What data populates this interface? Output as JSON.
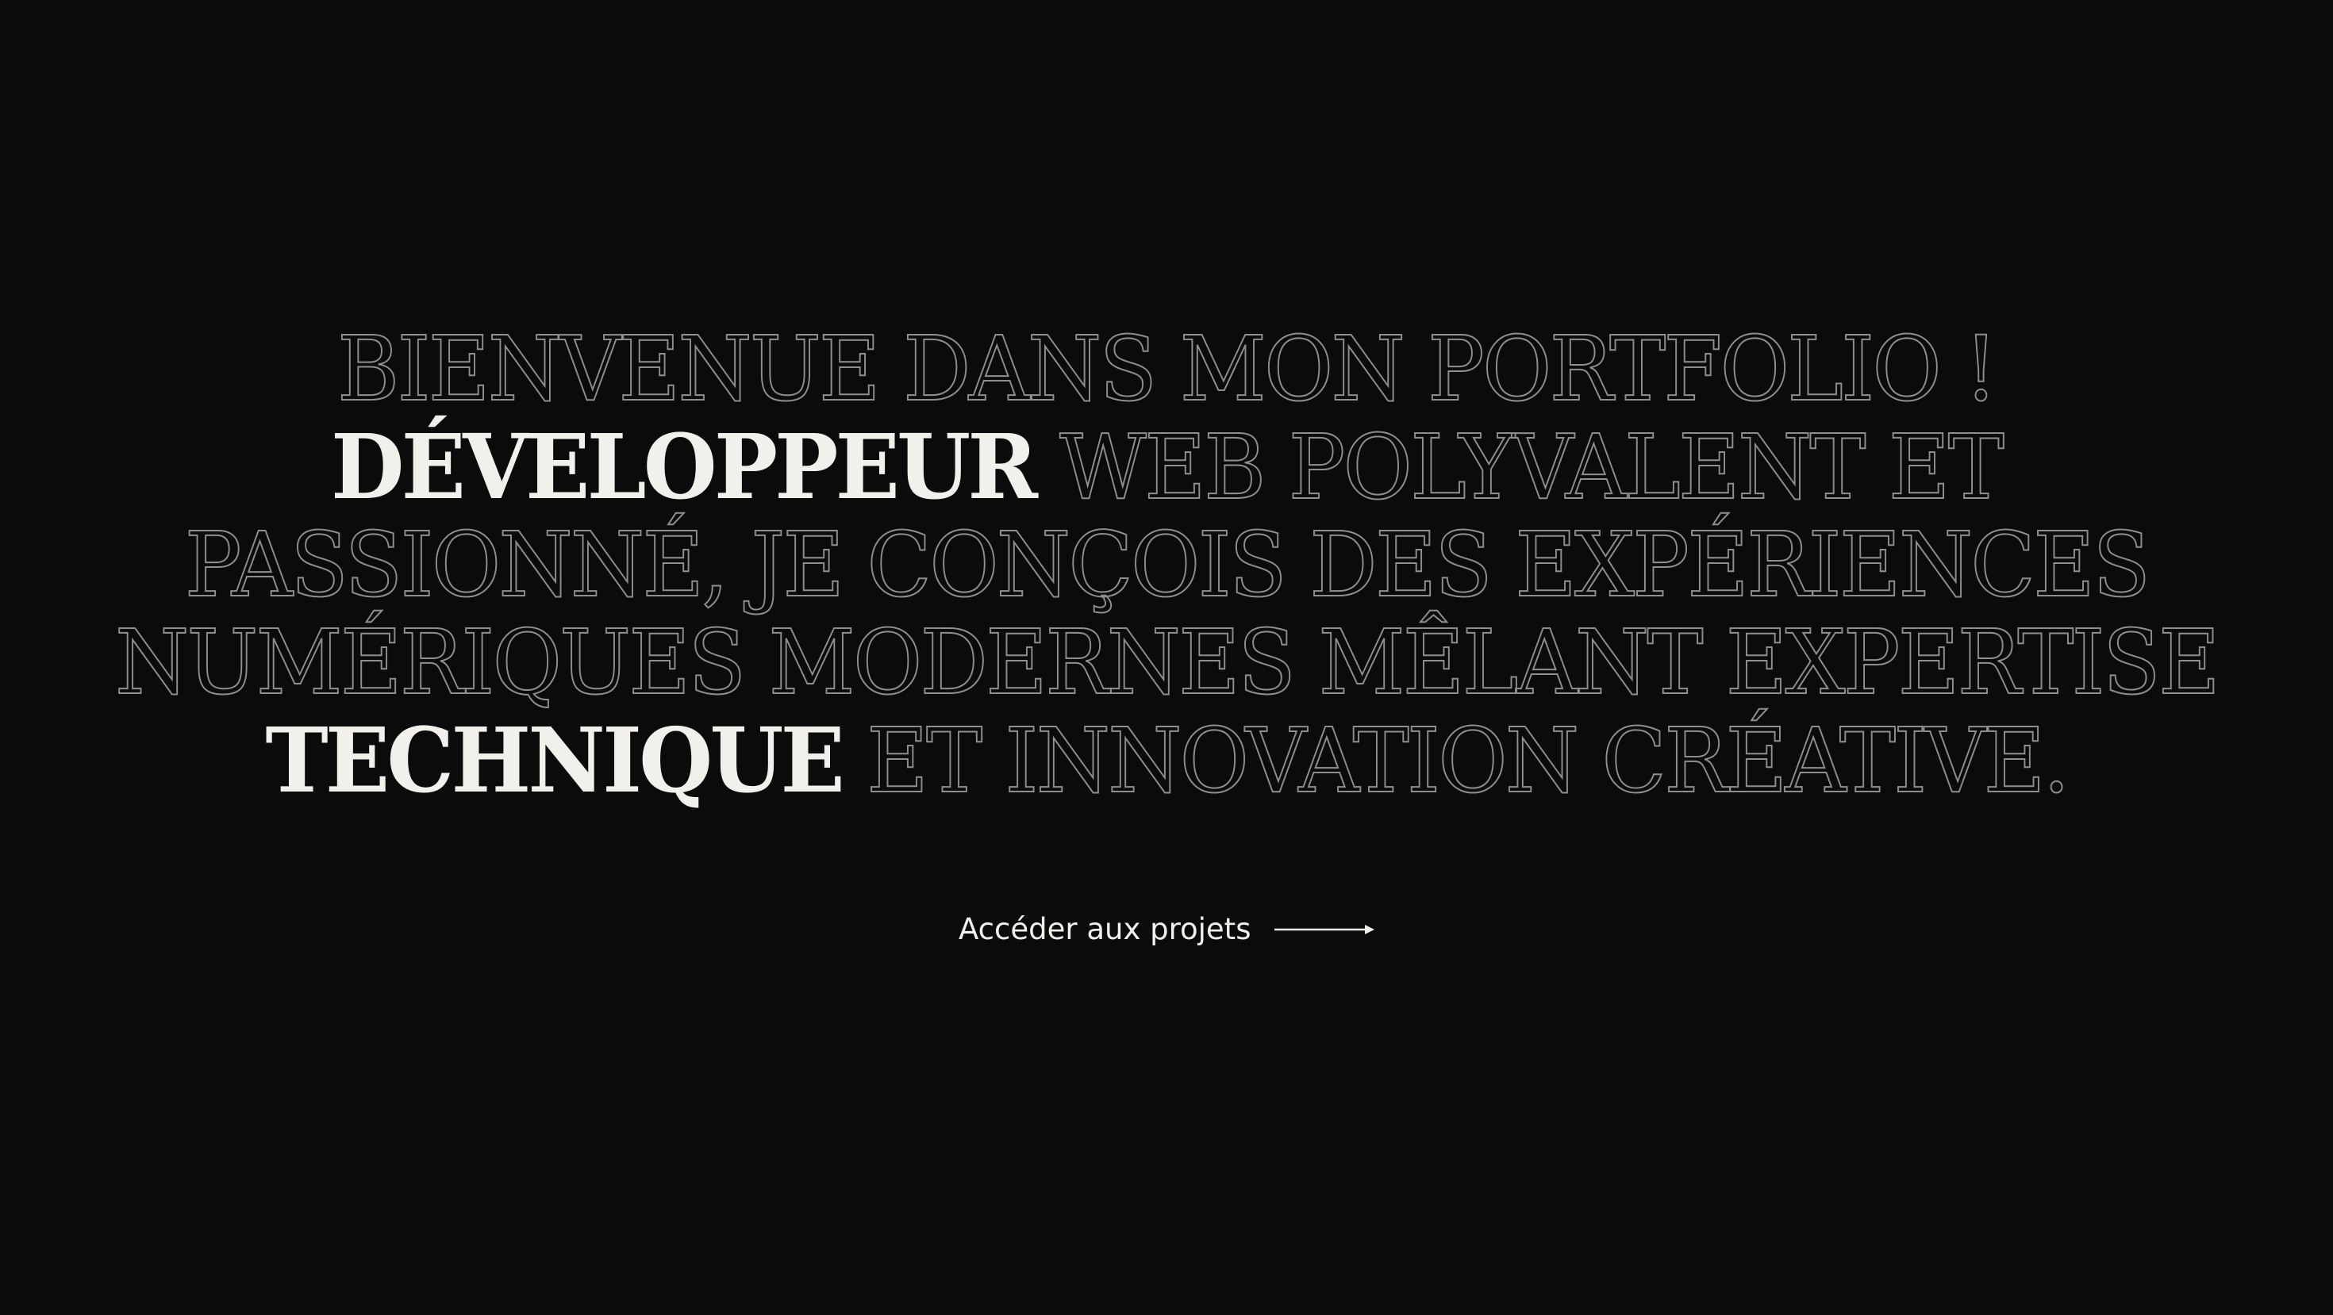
{
  "hero": {
    "lines": [
      [
        {
          "text": "BIENVENUE DANS MON PORTFOLIO !",
          "style": "outline"
        }
      ],
      [
        {
          "text": "DÉVELOPPEUR",
          "style": "solid"
        },
        {
          "text": " WEB POLYVALENT ET",
          "style": "outline"
        }
      ],
      [
        {
          "text": "PASSIONNÉ, JE CONÇOIS DES EXPÉRIENCES",
          "style": "outline"
        }
      ],
      [
        {
          "text": "NUMÉRIQUES MODERNES MÊLANT EXPERTISE",
          "style": "outline"
        }
      ],
      [
        {
          "text": "TECHNIQUE",
          "style": "solid"
        },
        {
          "text": " ET INNOVATION CRÉATIVE.",
          "style": "outline"
        }
      ]
    ]
  },
  "cta": {
    "label": "Accéder aux projets",
    "icon": "arrow-right-icon"
  },
  "colors": {
    "background": "#0b0b0b",
    "text_light": "#f2f0ea",
    "outline_stroke": "#8f8f8f"
  }
}
